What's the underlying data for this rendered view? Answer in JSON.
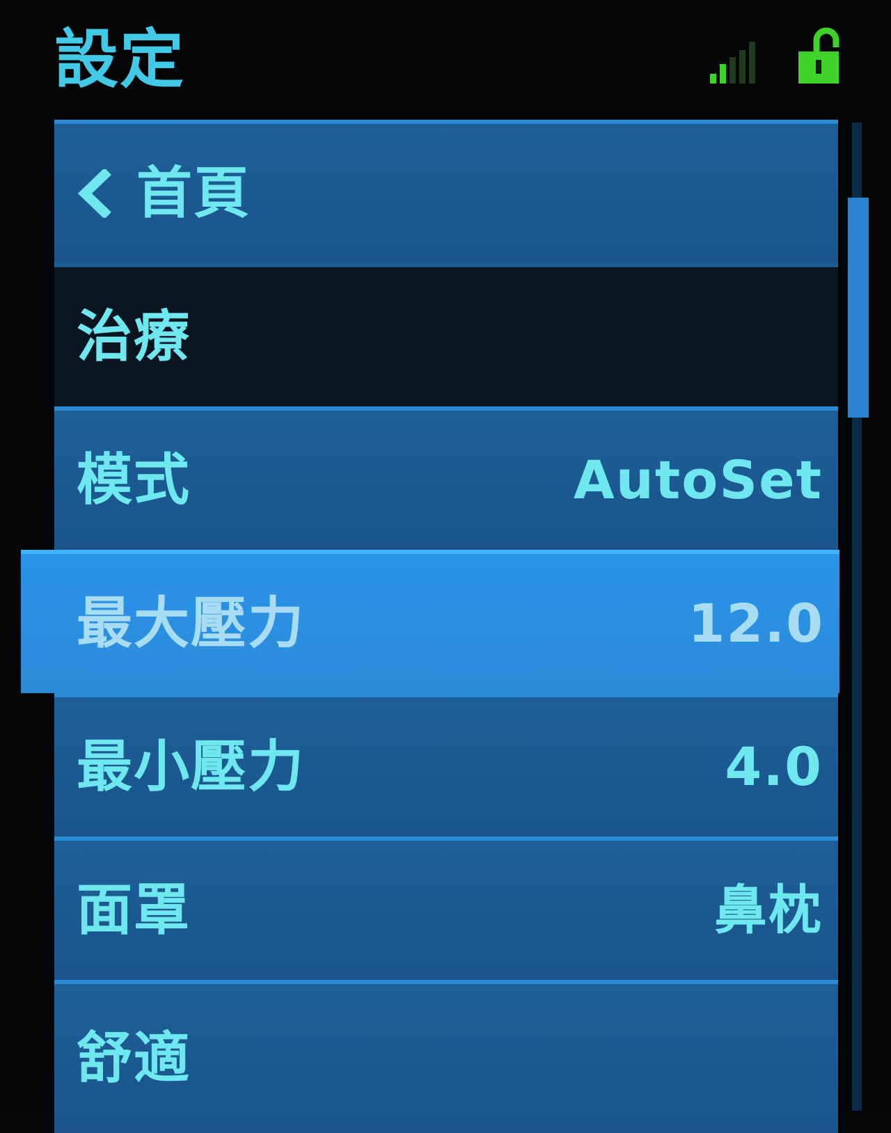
{
  "header": {
    "title": "設定"
  },
  "status": {
    "signal_icon": "signal-strength-icon",
    "lock_icon": "unlocked-padlock-icon",
    "signal_bars_on": 2,
    "signal_bars_total": 5
  },
  "nav": {
    "back_label": "首頁"
  },
  "menu": {
    "section_label": "治療",
    "items": [
      {
        "label": "模式",
        "value": "AutoSet"
      },
      {
        "label": "最大壓力",
        "value": "12.0"
      },
      {
        "label": "最小壓力",
        "value": "4.0"
      },
      {
        "label": "面罩",
        "value": "鼻枕"
      },
      {
        "label": "舒適",
        "value": ""
      }
    ]
  },
  "colors": {
    "title": "#41c9e6",
    "row_bg": "#1f5f99",
    "selected_bg": "#2a93e8",
    "text": "#6ee8ee",
    "signal_on": "#3fd22a"
  }
}
